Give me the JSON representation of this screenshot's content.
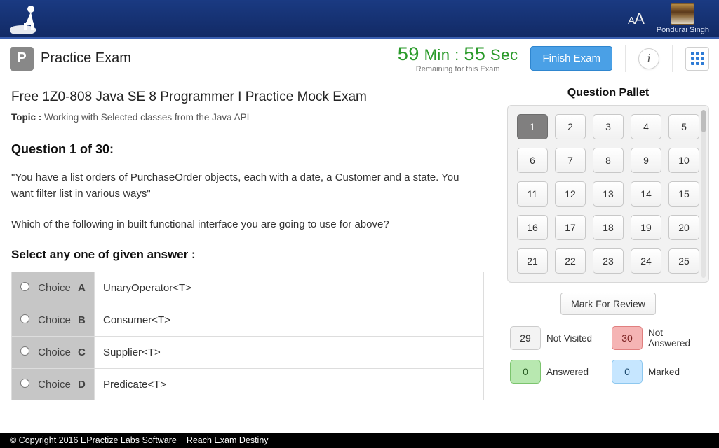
{
  "header": {
    "username": "Pondurai Singh"
  },
  "appbar": {
    "p_badge": "P",
    "title": "Practice Exam",
    "timer_min_value": "59",
    "timer_min_unit": "Min",
    "timer_sep": " : ",
    "timer_sec_value": "55",
    "timer_sec_unit": "Sec",
    "timer_sub": "Remaining for this Exam",
    "finish_label": "Finish Exam"
  },
  "exam": {
    "title": "Free 1Z0-808 Java SE 8 Programmer I Practice Mock Exam",
    "topic_label": "Topic :",
    "topic_value": "Working with Selected classes from the Java API",
    "question_heading": "Question 1 of 30:",
    "question_p1": "\"You have a list orders of PurchaseOrder objects, each with a date, a Customer and a state. You want filter list in various ways\"",
    "question_p2": "Which of the following in built functional interface you are going to use for above?",
    "select_heading": "Select any one of given answer :",
    "choice_label": "Choice",
    "choices": [
      {
        "letter": "A",
        "value": "UnaryOperator<T>"
      },
      {
        "letter": "B",
        "value": "Consumer<T>"
      },
      {
        "letter": "C",
        "value": "Supplier<T>"
      },
      {
        "letter": "D",
        "value": "Predicate<T>"
      }
    ]
  },
  "pallet": {
    "heading": "Question Pallet",
    "current": 1,
    "count": 25,
    "mark_label": "Mark For Review",
    "legend": {
      "not_visited_count": "29",
      "not_visited_label": "Not Visited",
      "not_answered_count": "30",
      "not_answered_label": "Not Answered",
      "answered_count": "0",
      "answered_label": "Answered",
      "marked_count": "0",
      "marked_label": "Marked"
    }
  },
  "footer": {
    "copyright": "© Copyright 2016 EPractize Labs Software",
    "tagline": "Reach Exam Destiny"
  }
}
